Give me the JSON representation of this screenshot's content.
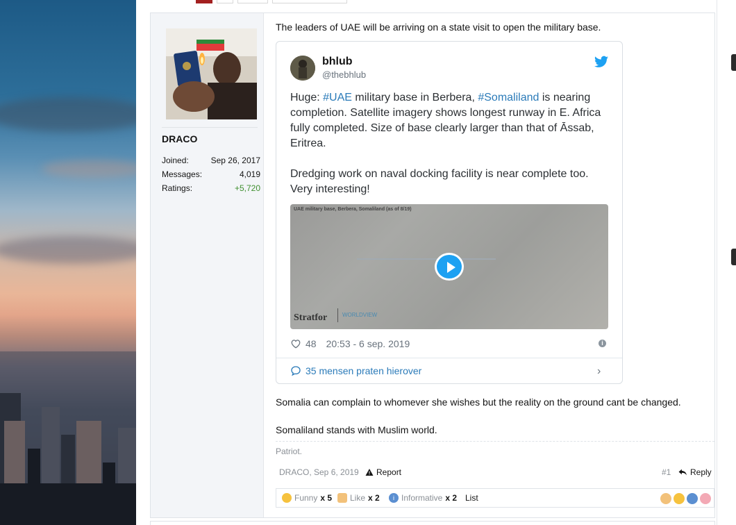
{
  "post": {
    "user": {
      "name": "DRACO",
      "stats": [
        {
          "label": "Joined:",
          "value": "Sep 26, 2017"
        },
        {
          "label": "Messages:",
          "value": "4,019"
        },
        {
          "label": "Ratings:",
          "value": "+5,720"
        }
      ]
    },
    "intro": "The leaders of UAE will be arriving on a state visit to open the military base.",
    "tweet": {
      "name": "bhlub",
      "handle": "@thebhlub",
      "text_prefix": "Huge: ",
      "hashtag1": "#UAE",
      "text_mid": " military base in Berbera, ",
      "hashtag2": "#Somaliland",
      "text_rest": " is nearing completion. Satellite imagery shows longest runway in E. Africa fully completed. Size of base clearly larger than that of Āssab, Eritrea.",
      "text_para2": "Dredging work on naval docking facility is near complete too. Very interesting!",
      "media_caption": "UAE military base, Berbera, Somaliland (as of 8/19)",
      "media_logo": "Stratfor",
      "media_logo2": "WORLDVIEW",
      "likes": "48",
      "timestamp": "20:53 - 6 sep. 2019",
      "replies": "35 mensen praten hierover"
    },
    "para2": "Somalia can complain to whomever she wishes but the reality on the ground cant be changed.",
    "para3": "Somaliland stands with Muslim world.",
    "signature": "Patriot.",
    "footer": {
      "author_date": "DRACO, Sep 6, 2019",
      "report": "Report",
      "number": "#1",
      "reply": "Reply"
    },
    "reactions": [
      {
        "label": "Funny",
        "count": "x 5"
      },
      {
        "label": "Like",
        "count": "x 2"
      },
      {
        "label": "Informative",
        "count": "x 2"
      }
    ],
    "reactions_list": "List"
  },
  "colors": {
    "link": "#2b7bb9",
    "rating_green": "#3f8f2f",
    "twitter_blue": "#1da1f2",
    "pager_active": "#a32020"
  }
}
